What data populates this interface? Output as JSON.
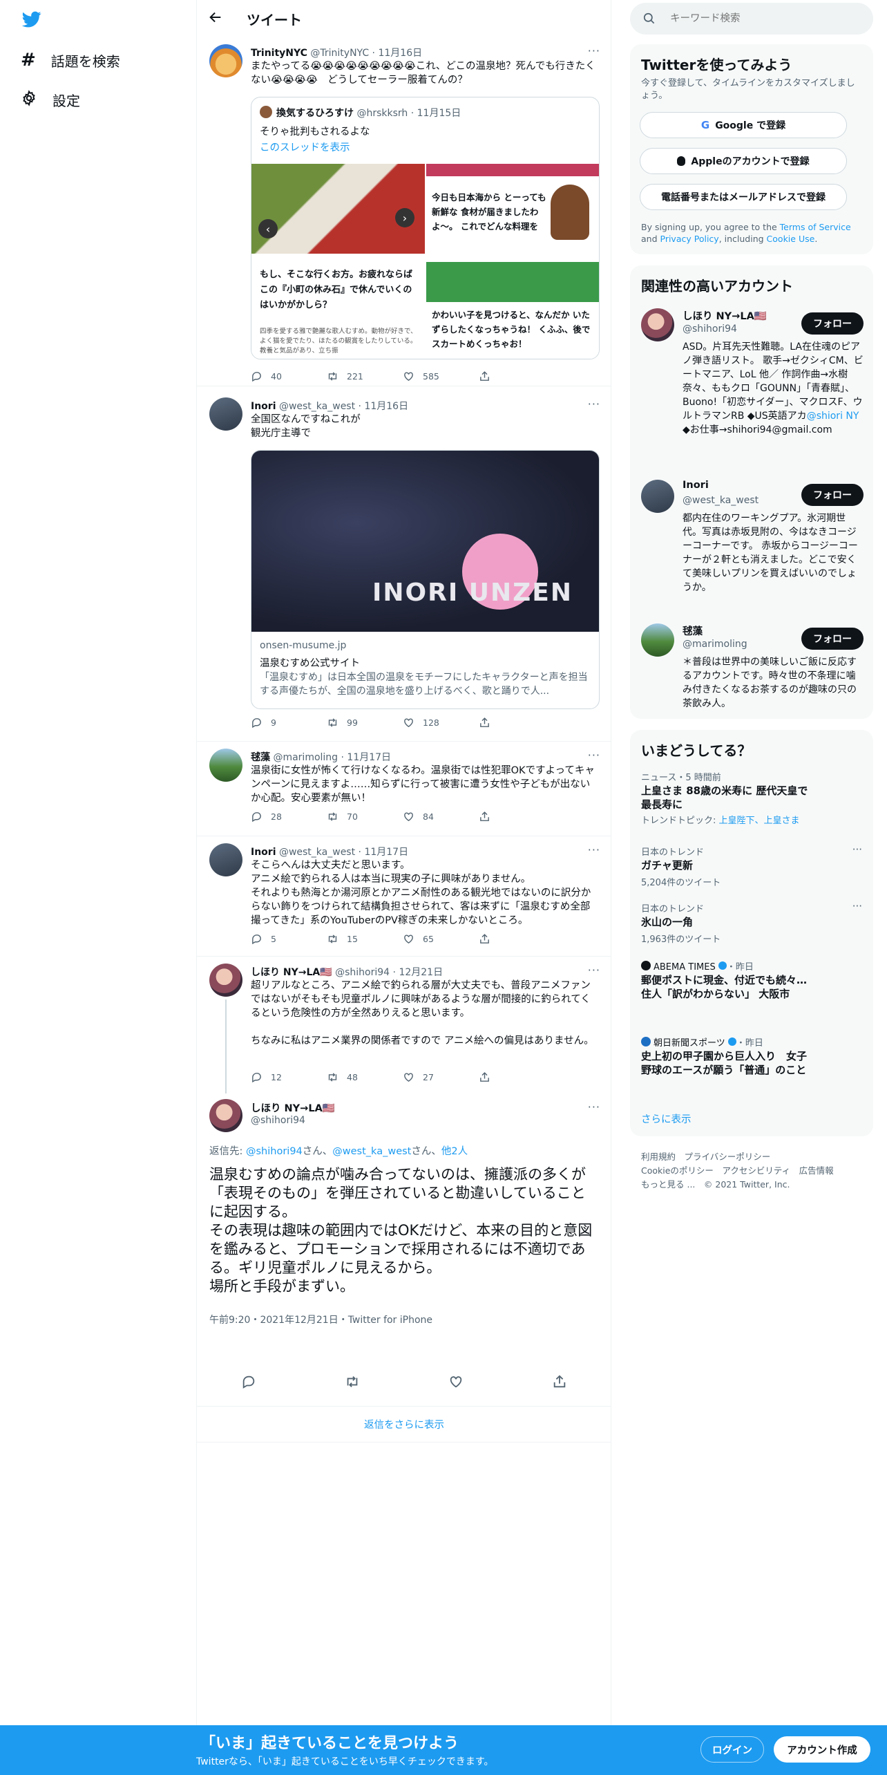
{
  "nav": {
    "explore": "話題を検索",
    "settings": "設定"
  },
  "header": {
    "title": "ツイート"
  },
  "search": {
    "placeholder": "キーワード検索"
  },
  "tweets": [
    {
      "name": "TrinityNYC",
      "handle": "@TrinityNYC",
      "date": "11月16日",
      "text": "またやってる😭😭😭😭😭😭😭😭😭これ、どこの温泉地？死んでも行きたくない😭😭😭😭　どうしてセーラー服着てんの？",
      "quote": {
        "name": "換気するひろすけ",
        "handle": "@hrskksrh",
        "date": "11月15日",
        "text": "そりゃ批判もされるよな",
        "link": "このスレッドを表示",
        "img_left_text": "もし、そこな行くお方。お疲れならばこの『小町の休み石』で休んでいくのはいかがかしら？",
        "img_left_small": "四季を愛する雅で艶麗な歌人むすめ。動物が好きで、よく猫を愛でたり、ほたるの観賞をしたりしている。教養と気品があり、立ち振",
        "img_right_top": "今日も日本海から とーっても新鮮な 食材が届きましたわよ〜。 これでどんな料理を",
        "img_right_bottom": "かわいい子を見つけると、なんだか いたずらしたくなっちゃうね！ くふふ、後でスカートめくっちゃお！"
      },
      "replies": "40",
      "retweets": "221",
      "likes": "585"
    },
    {
      "name": "Inori",
      "handle": "@west_ka_west",
      "date": "11月16日",
      "text": "全国区なんですねこれが\n観光庁主導で",
      "card": {
        "img_text": "INORI UNZEN",
        "domain": "onsen-musume.jp",
        "title": "温泉むすめ公式サイト",
        "desc": "「温泉むすめ」は日本全国の温泉をモチーフにしたキャラクターと声を担当する声優たちが、全国の温泉地を盛り上げるべく、歌と踊りで人..."
      },
      "replies": "9",
      "retweets": "99",
      "likes": "128"
    },
    {
      "name": "毬藻",
      "handle": "@marimoling",
      "date": "11月17日",
      "text": "温泉街に女性が怖くて行けなくなるわ。温泉街では性犯罪OKですよってキャンペーンに見えますよ……知らずに行って被害に遭う女性や子どもが出ないか心配。安心要素が無い！",
      "replies": "28",
      "retweets": "70",
      "likes": "84"
    },
    {
      "name": "Inori",
      "handle": "@west_ka_west",
      "date": "11月17日",
      "text": "そこらへんは大丈夫だと思います。\nアニメ絵で釣られる人は本当に現実の子に興味がありません。\nそれよりも熱海とか湯河原とかアニメ耐性のある観光地ではないのに訳分からない飾りをつけられて結構負担させられて、客は来ずに「温泉むすめ全部撮ってきた」系のYouTuberのPV稼ぎの未来しかないところ。",
      "replies": "5",
      "retweets": "15",
      "likes": "65"
    },
    {
      "name": "しほり NY→LA🇺🇸",
      "handle": "@shihori94",
      "date": "12月21日",
      "text": "超リアルなところ、アニメ絵で釣られる層が大丈夫でも、普段アニメファンではないがそもそも児童ポルノに興味があるような層が間接的に釣られてくるという危険性の方が全然ありえると思います。\n\nちなみに私はアニメ業界の関係者ですので アニメ絵への偏見はありません。",
      "replies": "12",
      "retweets": "48",
      "likes": "27"
    }
  ],
  "main_tweet": {
    "name": "しほり NY→LA🇺🇸",
    "handle": "@shihori94",
    "reply_prefix": "返信先: ",
    "reply_to_1": "@shihori94",
    "reply_mid1": "さん、",
    "reply_to_2": "@west_ka_west",
    "reply_mid2": "さん、",
    "reply_to_3": "他2人",
    "text": "温泉むすめの論点が噛み合ってないのは、擁護派の多くが「表現そのもの」を弾圧されていると勘違いしていることに起因する。\nその表現は趣味の範囲内ではOKだけど、本来の目的と意図を鑑みると、プロモーションで採用されるには不適切である。ギリ児童ポルノに見えるから。\n場所と手段がまずい。",
    "meta": "午前9:20・2021年12月21日・Twitter for iPhone"
  },
  "show_more": "返信をさらに表示",
  "signup": {
    "title": "Twitterを使ってみよう",
    "subtitle": "今すぐ登録して、タイムラインをカスタマイズしましょう。",
    "google": "Google で登録",
    "apple": "Appleのアカウントで登録",
    "phone": "電話番号またはメールアドレスで登録",
    "terms_1": "By signing up, you agree to the ",
    "terms_tos": "Terms of Service",
    "terms_2": " and ",
    "terms_privacy": "Privacy Policy",
    "terms_3": ", including ",
    "terms_cookie": "Cookie Use",
    "terms_4": "."
  },
  "related": {
    "title": "関連性の高いアカウント",
    "follow": "フォロー",
    "accounts": [
      {
        "name": "しほり NY→LA🇺🇸",
        "handle": "@shihori94",
        "bio": "ASD。片耳先天性難聴。LA在住魂のピアノ弾き語リスト。 歌手→ゼクシィCM、ビートマニア、LoL 他／ 作詞作曲→水樹奈々、ももクロ「GOUNN」「青春賦」、Buono!「初恋サイダー」、マクロスF、ウルトラマンRB ◆US英語アカ",
        "bio_link": "@shiori NY",
        "bio_end": " ◆お仕事→shihori94@gmail.com"
      },
      {
        "name": "Inori",
        "handle": "@west_ka_west",
        "bio": "都内在住のワーキングプア。氷河期世代。写真は赤坂見附の、今はなきコージーコーナーです。 赤坂からコージーコーナーが２軒とも消えました。どこで安くて美味しいプリンを買えばいいのでしょうか。"
      },
      {
        "name": "毬藻",
        "handle": "@marimoling",
        "bio": "＊普段は世界中の美味しいご飯に反応するアカウントです。時々世の不条理に噛み付きたくなるお茶するのが趣味の只の茶飲み人。"
      }
    ]
  },
  "trends": {
    "title": "いまどうしてる？",
    "items": [
      {
        "meta": "ニュース・5 時間前",
        "title": "上皇さま 88歳の米寿に 歴代天皇で最長寿に",
        "sub_prefix": "トレンドトピック: ",
        "sub_links": "上皇陛下、上皇さま"
      },
      {
        "meta": "日本のトレンド",
        "title": "ガチャ更新",
        "count": "5,204件のツイート"
      },
      {
        "meta": "日本のトレンド",
        "title": "氷山の一角",
        "count": "1,963件のツイート"
      },
      {
        "source": "ABEMA TIMES",
        "meta": "・昨日",
        "title": "郵便ポストに現金、付近でも続々…住人「訳がわからない」 大阪市"
      },
      {
        "source": "朝日新聞スポーツ",
        "meta": "・昨日",
        "title": "史上初の甲子園から巨人入り　女子野球のエースが願う「普通」のこと"
      }
    ],
    "more": "さらに表示"
  },
  "footer": {
    "l1a": "利用規約",
    "l1b": "プライバシーポリシー",
    "l2a": "Cookieのポリシー",
    "l2b": "アクセシビリティ",
    "l2c": "広告情報",
    "l3a": "もっと見る ...",
    "l3b": "© 2021 Twitter, Inc."
  },
  "bottom": {
    "title": "「いま」起きていることを見つけよう",
    "sub": "Twitterなら、「いま」起きていることをいち早くチェックできます。",
    "login": "ログイン",
    "signup": "アカウント作成"
  },
  "colors": {
    "accent": "#1d9bf0",
    "text": "#0f1419",
    "muted": "#536471"
  }
}
